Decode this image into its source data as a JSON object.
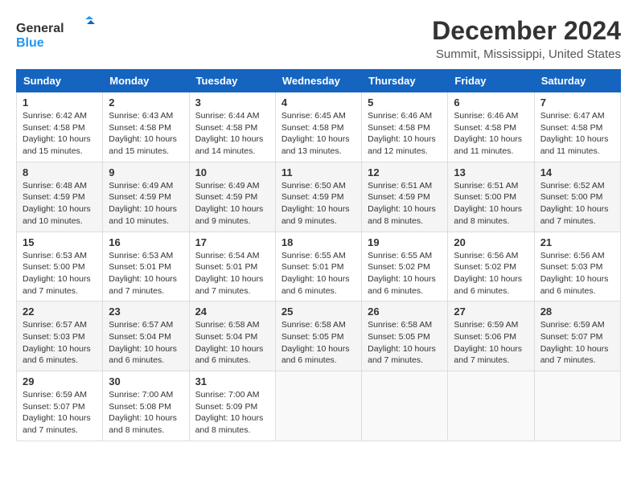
{
  "logo": {
    "line1": "General",
    "line2": "Blue"
  },
  "title": "December 2024",
  "location": "Summit, Mississippi, United States",
  "days_of_week": [
    "Sunday",
    "Monday",
    "Tuesday",
    "Wednesday",
    "Thursday",
    "Friday",
    "Saturday"
  ],
  "weeks": [
    [
      {
        "day": "1",
        "info": "Sunrise: 6:42 AM\nSunset: 4:58 PM\nDaylight: 10 hours\nand 15 minutes."
      },
      {
        "day": "2",
        "info": "Sunrise: 6:43 AM\nSunset: 4:58 PM\nDaylight: 10 hours\nand 15 minutes."
      },
      {
        "day": "3",
        "info": "Sunrise: 6:44 AM\nSunset: 4:58 PM\nDaylight: 10 hours\nand 14 minutes."
      },
      {
        "day": "4",
        "info": "Sunrise: 6:45 AM\nSunset: 4:58 PM\nDaylight: 10 hours\nand 13 minutes."
      },
      {
        "day": "5",
        "info": "Sunrise: 6:46 AM\nSunset: 4:58 PM\nDaylight: 10 hours\nand 12 minutes."
      },
      {
        "day": "6",
        "info": "Sunrise: 6:46 AM\nSunset: 4:58 PM\nDaylight: 10 hours\nand 11 minutes."
      },
      {
        "day": "7",
        "info": "Sunrise: 6:47 AM\nSunset: 4:58 PM\nDaylight: 10 hours\nand 11 minutes."
      }
    ],
    [
      {
        "day": "8",
        "info": "Sunrise: 6:48 AM\nSunset: 4:59 PM\nDaylight: 10 hours\nand 10 minutes."
      },
      {
        "day": "9",
        "info": "Sunrise: 6:49 AM\nSunset: 4:59 PM\nDaylight: 10 hours\nand 10 minutes."
      },
      {
        "day": "10",
        "info": "Sunrise: 6:49 AM\nSunset: 4:59 PM\nDaylight: 10 hours\nand 9 minutes."
      },
      {
        "day": "11",
        "info": "Sunrise: 6:50 AM\nSunset: 4:59 PM\nDaylight: 10 hours\nand 9 minutes."
      },
      {
        "day": "12",
        "info": "Sunrise: 6:51 AM\nSunset: 4:59 PM\nDaylight: 10 hours\nand 8 minutes."
      },
      {
        "day": "13",
        "info": "Sunrise: 6:51 AM\nSunset: 5:00 PM\nDaylight: 10 hours\nand 8 minutes."
      },
      {
        "day": "14",
        "info": "Sunrise: 6:52 AM\nSunset: 5:00 PM\nDaylight: 10 hours\nand 7 minutes."
      }
    ],
    [
      {
        "day": "15",
        "info": "Sunrise: 6:53 AM\nSunset: 5:00 PM\nDaylight: 10 hours\nand 7 minutes."
      },
      {
        "day": "16",
        "info": "Sunrise: 6:53 AM\nSunset: 5:01 PM\nDaylight: 10 hours\nand 7 minutes."
      },
      {
        "day": "17",
        "info": "Sunrise: 6:54 AM\nSunset: 5:01 PM\nDaylight: 10 hours\nand 7 minutes."
      },
      {
        "day": "18",
        "info": "Sunrise: 6:55 AM\nSunset: 5:01 PM\nDaylight: 10 hours\nand 6 minutes."
      },
      {
        "day": "19",
        "info": "Sunrise: 6:55 AM\nSunset: 5:02 PM\nDaylight: 10 hours\nand 6 minutes."
      },
      {
        "day": "20",
        "info": "Sunrise: 6:56 AM\nSunset: 5:02 PM\nDaylight: 10 hours\nand 6 minutes."
      },
      {
        "day": "21",
        "info": "Sunrise: 6:56 AM\nSunset: 5:03 PM\nDaylight: 10 hours\nand 6 minutes."
      }
    ],
    [
      {
        "day": "22",
        "info": "Sunrise: 6:57 AM\nSunset: 5:03 PM\nDaylight: 10 hours\nand 6 minutes."
      },
      {
        "day": "23",
        "info": "Sunrise: 6:57 AM\nSunset: 5:04 PM\nDaylight: 10 hours\nand 6 minutes."
      },
      {
        "day": "24",
        "info": "Sunrise: 6:58 AM\nSunset: 5:04 PM\nDaylight: 10 hours\nand 6 minutes."
      },
      {
        "day": "25",
        "info": "Sunrise: 6:58 AM\nSunset: 5:05 PM\nDaylight: 10 hours\nand 6 minutes."
      },
      {
        "day": "26",
        "info": "Sunrise: 6:58 AM\nSunset: 5:05 PM\nDaylight: 10 hours\nand 7 minutes."
      },
      {
        "day": "27",
        "info": "Sunrise: 6:59 AM\nSunset: 5:06 PM\nDaylight: 10 hours\nand 7 minutes."
      },
      {
        "day": "28",
        "info": "Sunrise: 6:59 AM\nSunset: 5:07 PM\nDaylight: 10 hours\nand 7 minutes."
      }
    ],
    [
      {
        "day": "29",
        "info": "Sunrise: 6:59 AM\nSunset: 5:07 PM\nDaylight: 10 hours\nand 7 minutes."
      },
      {
        "day": "30",
        "info": "Sunrise: 7:00 AM\nSunset: 5:08 PM\nDaylight: 10 hours\nand 8 minutes."
      },
      {
        "day": "31",
        "info": "Sunrise: 7:00 AM\nSunset: 5:09 PM\nDaylight: 10 hours\nand 8 minutes."
      },
      null,
      null,
      null,
      null
    ]
  ]
}
